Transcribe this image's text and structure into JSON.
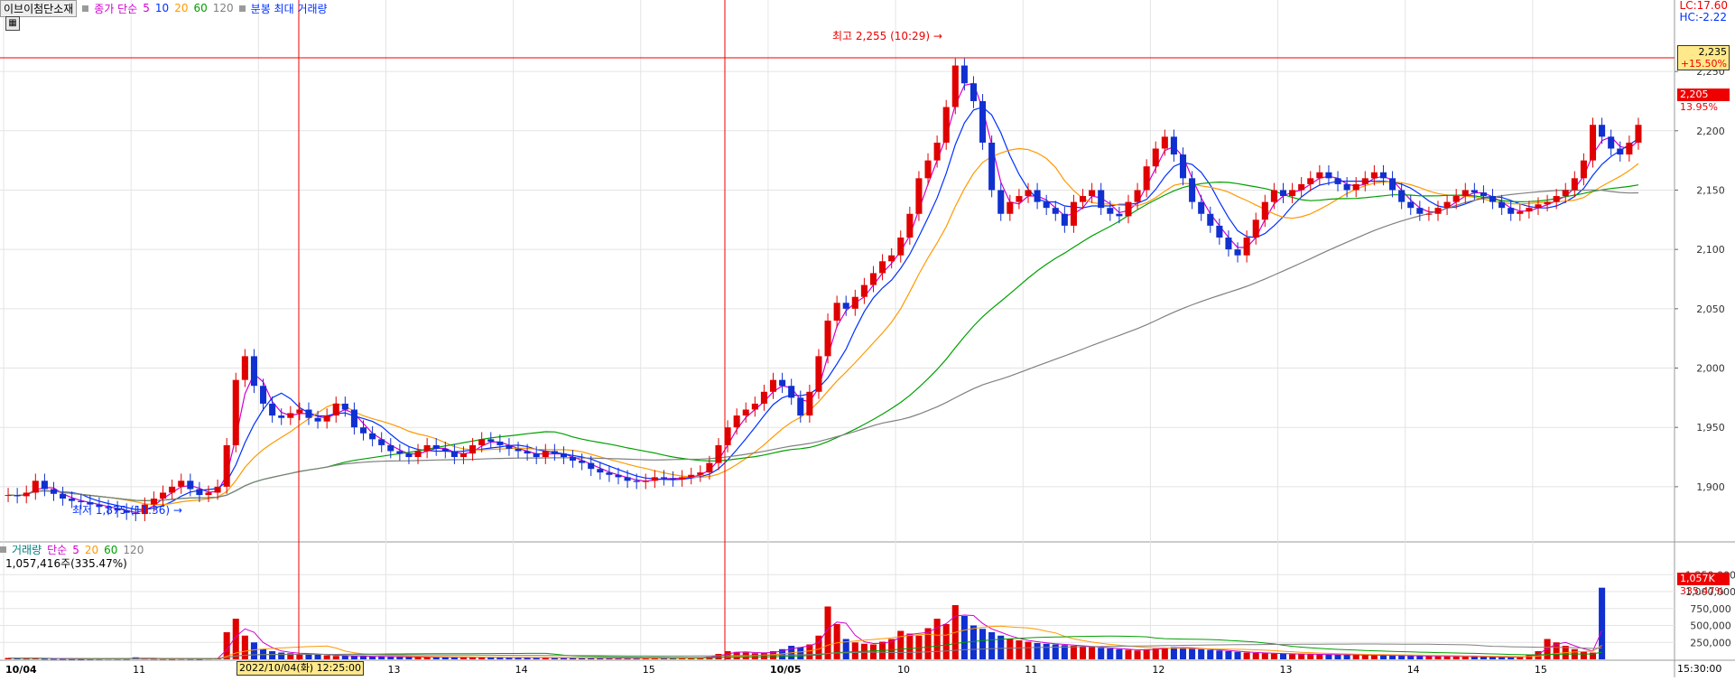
{
  "header": {
    "title": "이브이첨단소재",
    "ma_label": "종가 단순",
    "ma_periods": [
      "5",
      "10",
      "20",
      "60",
      "120"
    ],
    "ma_colors": [
      "#d100d1",
      "#0030ff",
      "#ff9900",
      "#00a000",
      "#808080"
    ],
    "bar_label": "분봉 최대 거래량"
  },
  "right_info": {
    "lc": "LC:17.60",
    "hc": "HC:-2.22"
  },
  "price_marker": {
    "price": "2,235",
    "pct": "+15.50%"
  },
  "current_marker": {
    "price": "2,205",
    "pct": "13.95%"
  },
  "annotations": {
    "high": "최고 2,255 (10:29)",
    "low": "최저 1,875 (11:36)"
  },
  "volume_header": {
    "label": "거래량",
    "ma_label": "단순",
    "periods": [
      "5",
      "20",
      "60",
      "120"
    ],
    "colors": [
      "#d100d1",
      "#ff9900",
      "#00a000",
      "#808080"
    ]
  },
  "volume_info": "1,057,416주(335.47%)",
  "volume_marker": {
    "value": "1,057K",
    "pct": "335.47%"
  },
  "x_axis": {
    "cursor_time": "2022/10/04(화) 12:25:00",
    "end_time": "15:30:00"
  },
  "colors": {
    "up": "#e00000",
    "down": "#1030d0",
    "crosshair": "#e00000"
  },
  "chart_data": {
    "type": "candlestick",
    "title": "이브이첨단소재",
    "price_axis": {
      "ticks": [
        1900,
        1950,
        2000,
        2050,
        2100,
        2150,
        2200,
        2250
      ],
      "tick_labels": [
        "1,900",
        "1,950",
        "2,000",
        "2,050",
        "2,100",
        "2,150",
        "2,200",
        "2,250"
      ],
      "range": [
        1855,
        2295
      ]
    },
    "volume_axis": {
      "ticks": [
        250000,
        500000,
        750000,
        1000000,
        1250000
      ],
      "tick_labels": [
        "250,000",
        "500,000",
        "750,000",
        "1,000,000",
        "1,250,000"
      ],
      "range": [
        0,
        1400000
      ]
    },
    "x_labels": [
      "10/04",
      "11",
      "12",
      "13",
      "14",
      "15",
      "10/05",
      "10",
      "11",
      "12",
      "13",
      "14",
      "15"
    ],
    "high": 2255,
    "low": 1875,
    "reference_price": 2235,
    "last_price": 2205,
    "last_volume": 1057416,
    "price_series": [
      1893,
      1892,
      1895,
      1905,
      1898,
      1894,
      1890,
      1888,
      1887,
      1885,
      1883,
      1882,
      1880,
      1878,
      1877,
      1885,
      1890,
      1895,
      1900,
      1905,
      1898,
      1893,
      1895,
      1900,
      1935,
      1990,
      2010,
      1985,
      1970,
      1960,
      1958,
      1962,
      1965,
      1958,
      1955,
      1960,
      1970,
      1965,
      1950,
      1945,
      1940,
      1935,
      1930,
      1928,
      1925,
      1930,
      1935,
      1932,
      1930,
      1925,
      1928,
      1935,
      1940,
      1938,
      1935,
      1932,
      1930,
      1928,
      1925,
      1930,
      1928,
      1925,
      1922,
      1920,
      1915,
      1912,
      1910,
      1908,
      1905,
      1904,
      1905,
      1908,
      1907,
      1906,
      1908,
      1910,
      1912,
      1920,
      1935,
      1950,
      1960,
      1965,
      1970,
      1980,
      1990,
      1985,
      1975,
      1960,
      1980,
      2010,
      2040,
      2055,
      2050,
      2060,
      2070,
      2080,
      2090,
      2095,
      2110,
      2130,
      2160,
      2175,
      2190,
      2220,
      2255,
      2240,
      2225,
      2190,
      2150,
      2130,
      2140,
      2145,
      2150,
      2140,
      2135,
      2130,
      2120,
      2140,
      2145,
      2150,
      2135,
      2130,
      2128,
      2140,
      2150,
      2170,
      2185,
      2195,
      2180,
      2160,
      2140,
      2130,
      2120,
      2110,
      2100,
      2095,
      2110,
      2125,
      2140,
      2150,
      2145,
      2150,
      2155,
      2160,
      2165,
      2160,
      2155,
      2150,
      2155,
      2160,
      2165,
      2160,
      2150,
      2140,
      2135,
      2130,
      2130,
      2135,
      2140,
      2145,
      2150,
      2148,
      2145,
      2140,
      2135,
      2130,
      2132,
      2135,
      2138,
      2140,
      2145,
      2150,
      2160,
      2175,
      2205,
      2195,
      2185,
      2180,
      2190,
      2205
    ],
    "volume_series": [
      20000,
      15000,
      12000,
      18000,
      10000,
      9000,
      8000,
      7000,
      6000,
      8000,
      9000,
      11000,
      10000,
      9000,
      30000,
      12000,
      10000,
      9000,
      8000,
      10000,
      9000,
      8000,
      12000,
      15000,
      400000,
      600000,
      350000,
      250000,
      150000,
      120000,
      100000,
      90000,
      80000,
      85000,
      70000,
      60000,
      50000,
      55000,
      48000,
      45000,
      40000,
      42000,
      38000,
      36000,
      35000,
      34000,
      33000,
      32000,
      31000,
      30000,
      29000,
      32000,
      30000,
      28000,
      27000,
      26000,
      25000,
      26000,
      24000,
      23000,
      22000,
      21000,
      20000,
      22000,
      19000,
      18000,
      17000,
      18000,
      16000,
      15000,
      16000,
      17000,
      18000,
      19000,
      20000,
      25000,
      30000,
      40000,
      80000,
      120000,
      110000,
      100000,
      90000,
      95000,
      120000,
      150000,
      200000,
      180000,
      220000,
      350000,
      780000,
      520000,
      300000,
      250000,
      230000,
      220000,
      260000,
      300000,
      420000,
      380000,
      350000,
      460000,
      600000,
      520000,
      800000,
      640000,
      500000,
      450000,
      400000,
      350000,
      300000,
      280000,
      260000,
      240000,
      230000,
      220000,
      210000,
      200000,
      190000,
      180000,
      170000,
      160000,
      150000,
      140000,
      130000,
      150000,
      160000,
      170000,
      180000,
      170000,
      160000,
      150000,
      140000,
      130000,
      120000,
      110000,
      100000,
      95000,
      90000,
      85000,
      80000,
      78000,
      76000,
      74000,
      72000,
      70000,
      68000,
      66000,
      64000,
      62000,
      60000,
      58000,
      56000,
      54000,
      52000,
      50000,
      48000,
      46000,
      44000,
      42000,
      40000,
      38000,
      36000,
      34000,
      32000,
      30000,
      40000,
      60000,
      120000,
      300000,
      250000,
      200000,
      150000,
      120000,
      100000,
      1057416
    ],
    "ma_series": [
      {
        "name": "5",
        "color": "#d100d1"
      },
      {
        "name": "10",
        "color": "#0030ff"
      },
      {
        "name": "20",
        "color": "#ff9900"
      },
      {
        "name": "60",
        "color": "#00a000"
      },
      {
        "name": "120",
        "color": "#808080"
      }
    ]
  }
}
